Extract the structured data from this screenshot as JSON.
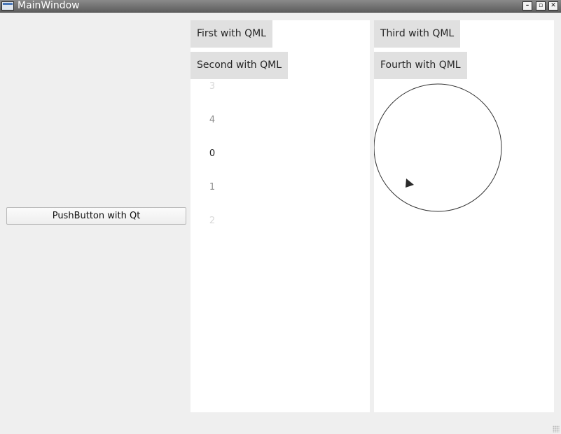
{
  "window": {
    "title": "MainWindow",
    "buttons": {
      "minimize": "–",
      "restore": "▫",
      "close": "✕"
    }
  },
  "left_panel": {
    "push_button_label": "PushButton with Qt"
  },
  "qml_left": {
    "first_label": "First with QML",
    "second_label": "Second with QML",
    "tumbler": [
      {
        "text": "3",
        "color": "#d8d8d8"
      },
      {
        "text": "4",
        "color": "#8f8f8f"
      },
      {
        "text": "0",
        "color": "#222222"
      },
      {
        "text": "1",
        "color": "#8f8f8f"
      },
      {
        "text": "2",
        "color": "#d8d8d8"
      }
    ]
  },
  "qml_right": {
    "third_label": "Third with QML",
    "fourth_label": "Fourth with QML",
    "dial": {
      "value": 0
    }
  },
  "colors": {
    "background": "#efefef",
    "pane": "#ffffff",
    "qml_button": "#e0e0e0",
    "titlebar": "#6f6f6f"
  }
}
